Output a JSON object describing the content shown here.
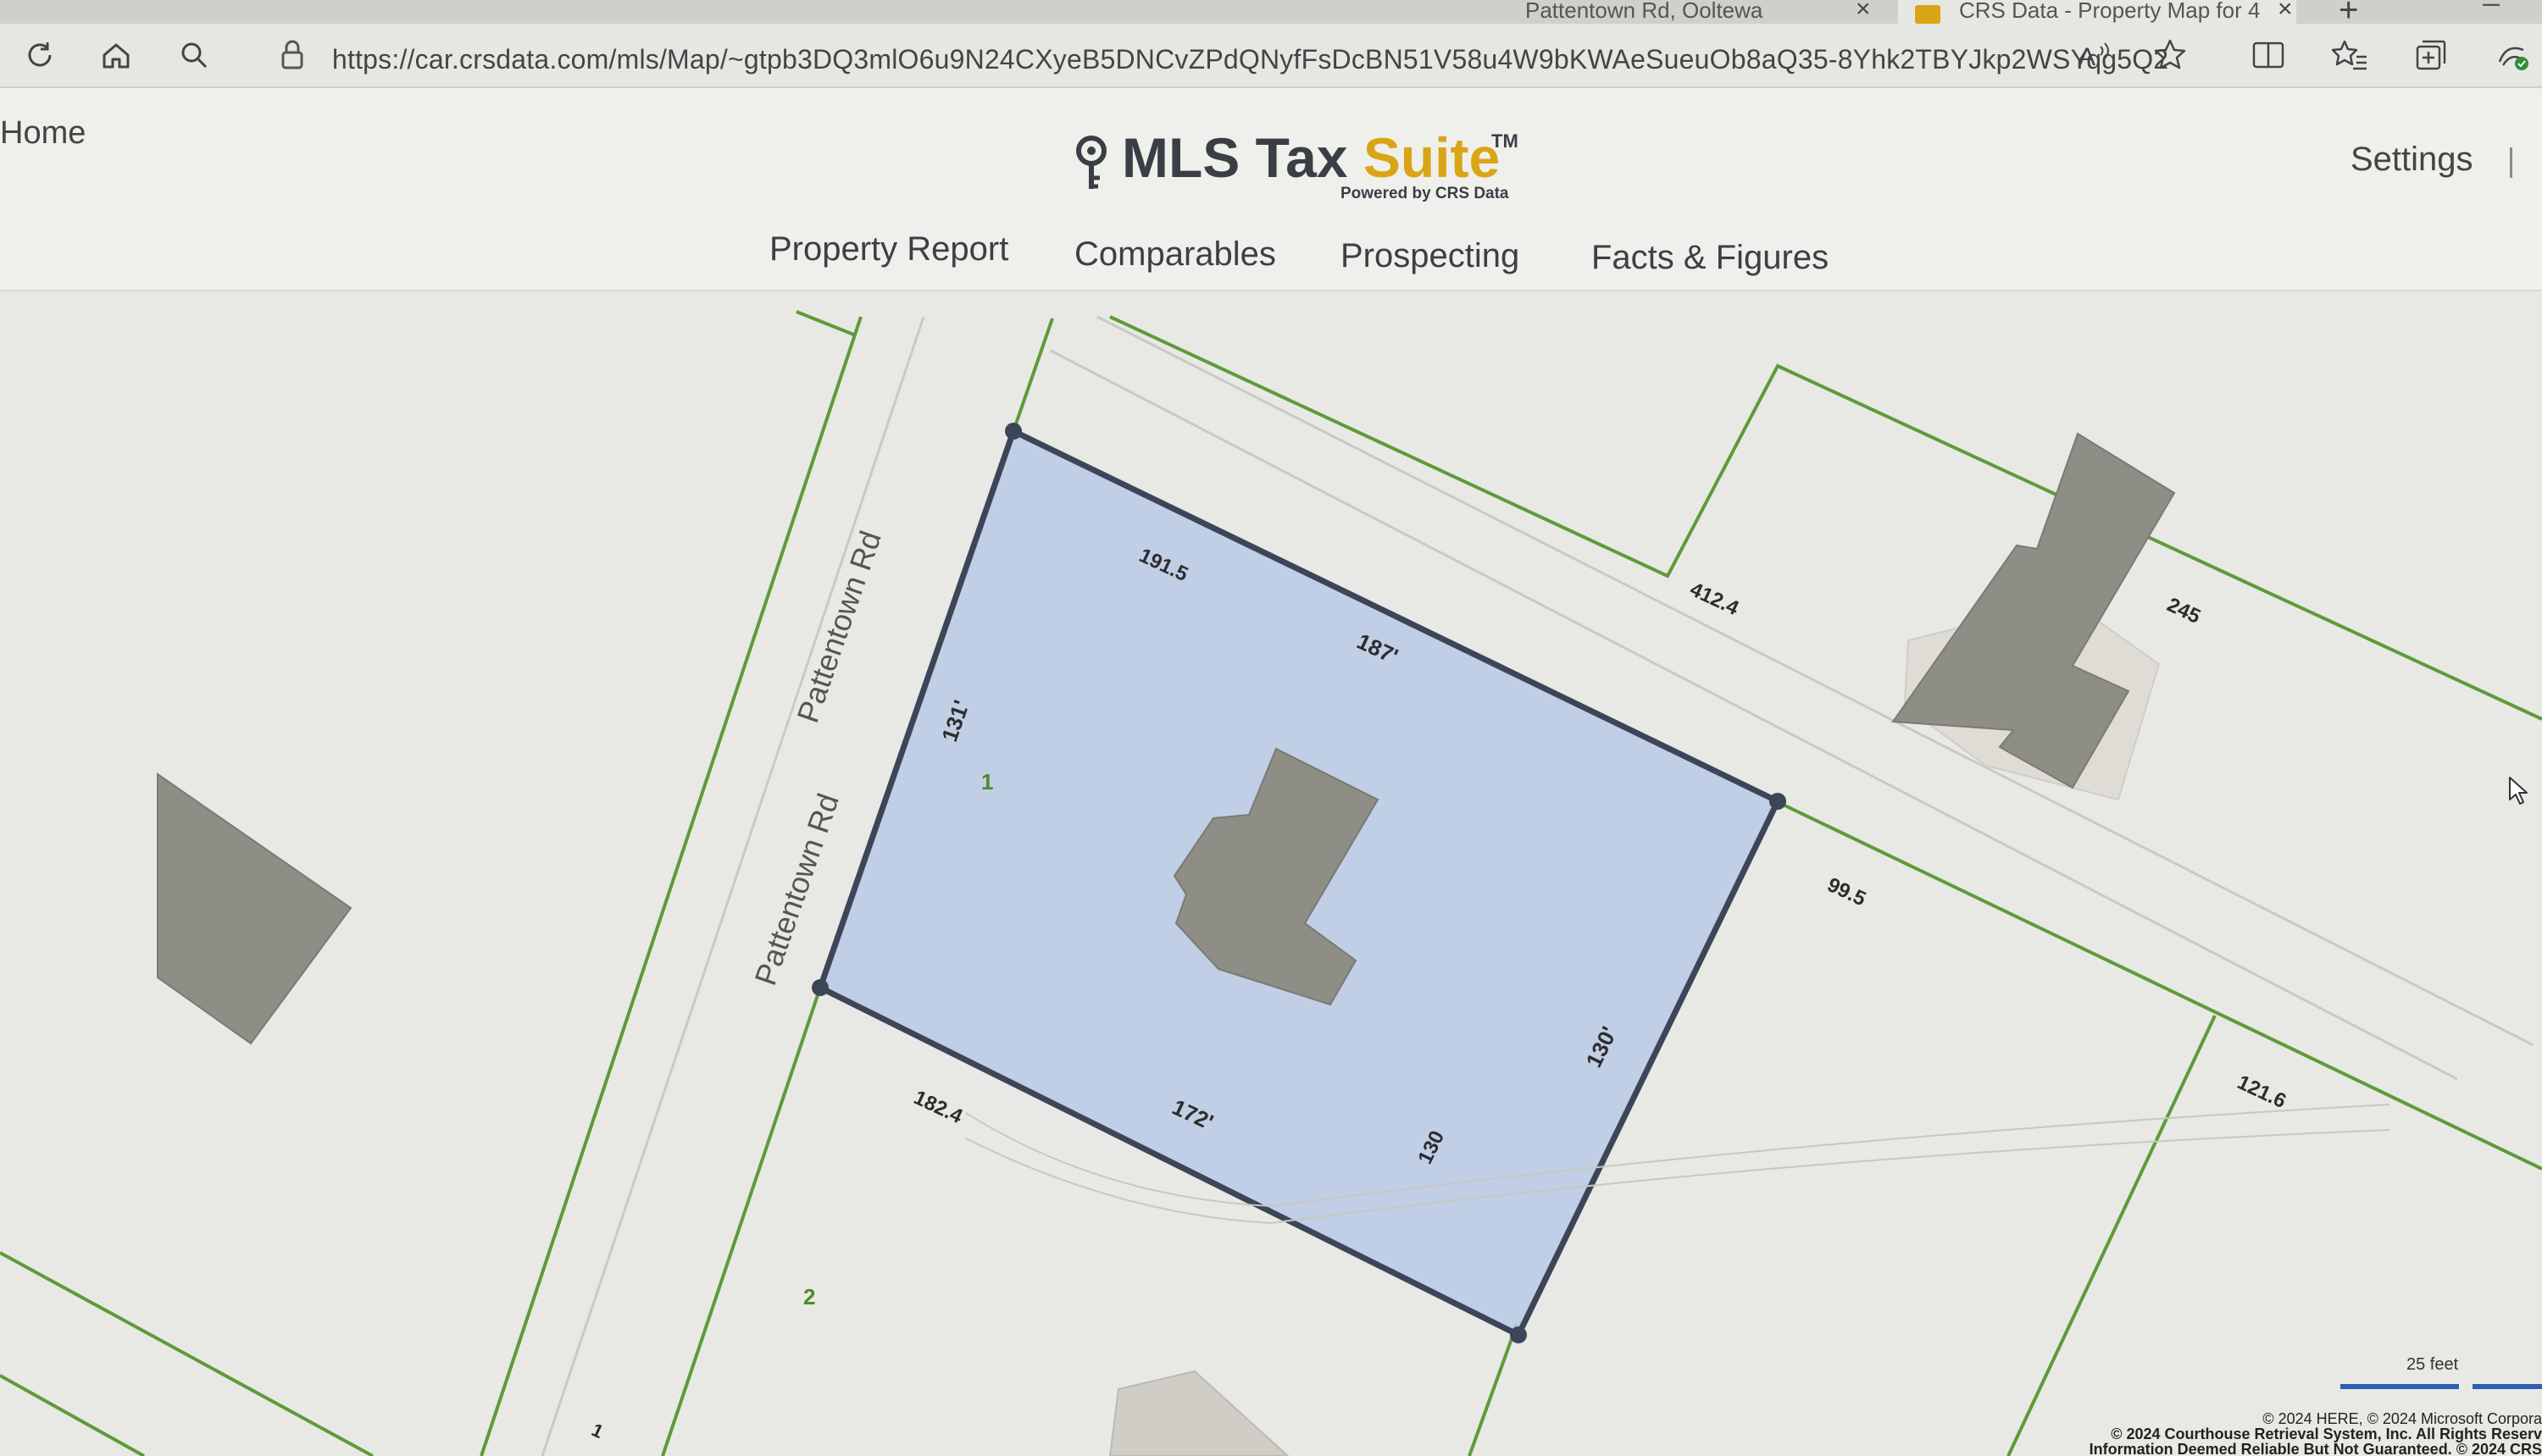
{
  "browser": {
    "tabs": [
      {
        "label": "Pattentown Rd, Ooltewa"
      },
      {
        "label": "CRS Data - Property Map for 4"
      }
    ],
    "url": "https://car.crsdata.com/mls/Map/~gtpb3DQ3mlO6u9N24CXyeB5DNCvZPdQNyfFsDcBN51V58u4W9bKWAeSueuOb8aQ35-8Yhk2TBYJkp2WSYqg5Q2",
    "toolbar_icons": [
      "refresh-icon",
      "home-icon",
      "search-icon",
      "lock-icon",
      "read-aloud-icon",
      "favorite-star-icon",
      "split-screen-icon",
      "favorites-list-icon",
      "collections-icon",
      "extensions-icon"
    ]
  },
  "header": {
    "home_label": "Home",
    "settings_label": "Settings",
    "logo": {
      "main": "MLS Tax",
      "accent": "Suite",
      "tm": "TM",
      "powered_by": "Powered by CRS Data"
    },
    "nav": [
      {
        "label": "Property Report"
      },
      {
        "label": "Comparables"
      },
      {
        "label": "Prospecting"
      },
      {
        "label": "Facts & Figures"
      }
    ]
  },
  "map": {
    "road_labels": [
      "Pattentown Rd",
      "Pattentown Rd"
    ],
    "parcel_numbers": [
      "1",
      "2"
    ],
    "dimension_labels": [
      "191.5",
      "187'",
      "131'",
      "182.4",
      "172'",
      "130'",
      "130",
      "412.4",
      "245",
      "99.5",
      "121.6",
      "1"
    ],
    "scale_label": "25 feet",
    "attribution": [
      "© 2024 HERE, © 2024 Microsoft Corpora",
      "© 2024 Courthouse Retrieval System, Inc. All Rights Reserv",
      "Information Deemed Reliable But Not Guaranteed. © 2024 CRS"
    ]
  },
  "colors": {
    "accent": "#d9a514",
    "parcel_fill": "#b9c9e6",
    "parcel_outline": "#3d4658",
    "lot_lines": "#5f9a3a",
    "building": "#8e8d86"
  }
}
